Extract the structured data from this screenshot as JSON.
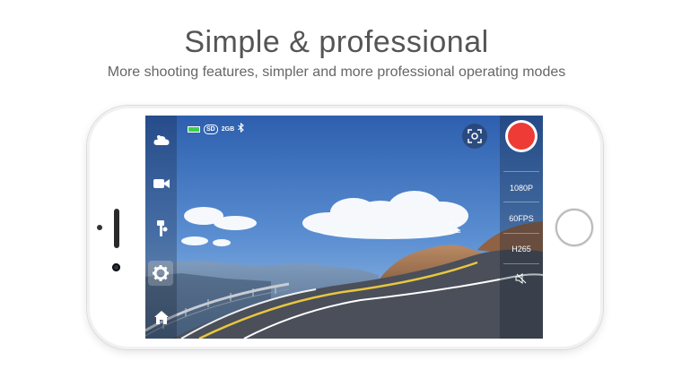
{
  "promo": {
    "title": "Simple & professional",
    "subtitle": "More shooting features, simpler and more professional operating modes"
  },
  "sidebar": {
    "items": [
      {
        "name": "weather-mode",
        "icon": "cloud-icon"
      },
      {
        "name": "video-mode",
        "icon": "video-camera-icon"
      },
      {
        "name": "tools",
        "icon": "gimbal-icon"
      },
      {
        "name": "settings",
        "icon": "gear-icon",
        "active": true
      },
      {
        "name": "home",
        "icon": "home-icon"
      }
    ]
  },
  "status_bar": {
    "battery_color": "#3bd14a",
    "sd_label": "SD",
    "storage_label": "2GB",
    "bluetooth_icon": "bluetooth-icon"
  },
  "camera": {
    "record_color": "#ee3b35",
    "resolution": "1080P",
    "framerate": "60FPS",
    "codec": "H265",
    "mute_icon": "speaker-muted-icon"
  }
}
